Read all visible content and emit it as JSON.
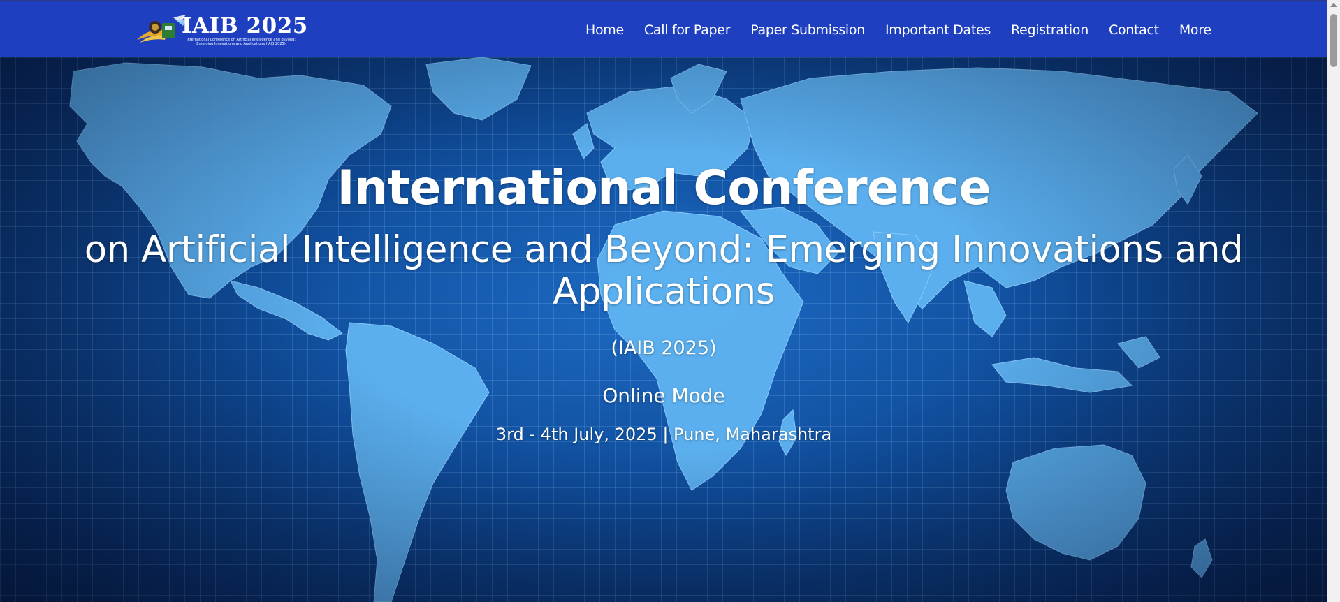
{
  "colors": {
    "header_bg": "#1d3fc0",
    "hero_bg": "#0f4c9a",
    "map_land": "#5fb4f2",
    "text": "#ffffff"
  },
  "header": {
    "logo": {
      "title": "IAIB 2025",
      "subtitle": "International Conference on Artificial Intelligence and Beyond: Emerging Innovations and Applications (IAIB 2025)",
      "icon": "conference-emblem-icon"
    },
    "nav": [
      {
        "label": "Home"
      },
      {
        "label": "Call for Paper"
      },
      {
        "label": "Paper Submission"
      },
      {
        "label": "Important Dates"
      },
      {
        "label": "Registration"
      },
      {
        "label": "Contact"
      },
      {
        "label": "More"
      }
    ]
  },
  "hero": {
    "background_icon": "world-map-icon",
    "title": "International Conference",
    "subtitle": "on Artificial Intelligence and Beyond: Emerging Innovations and Applications",
    "abbreviation": "(IAIB 2025)",
    "mode": "Online Mode",
    "date_location": "3rd - 4th July, 2025 | Pune, Maharashtra"
  }
}
